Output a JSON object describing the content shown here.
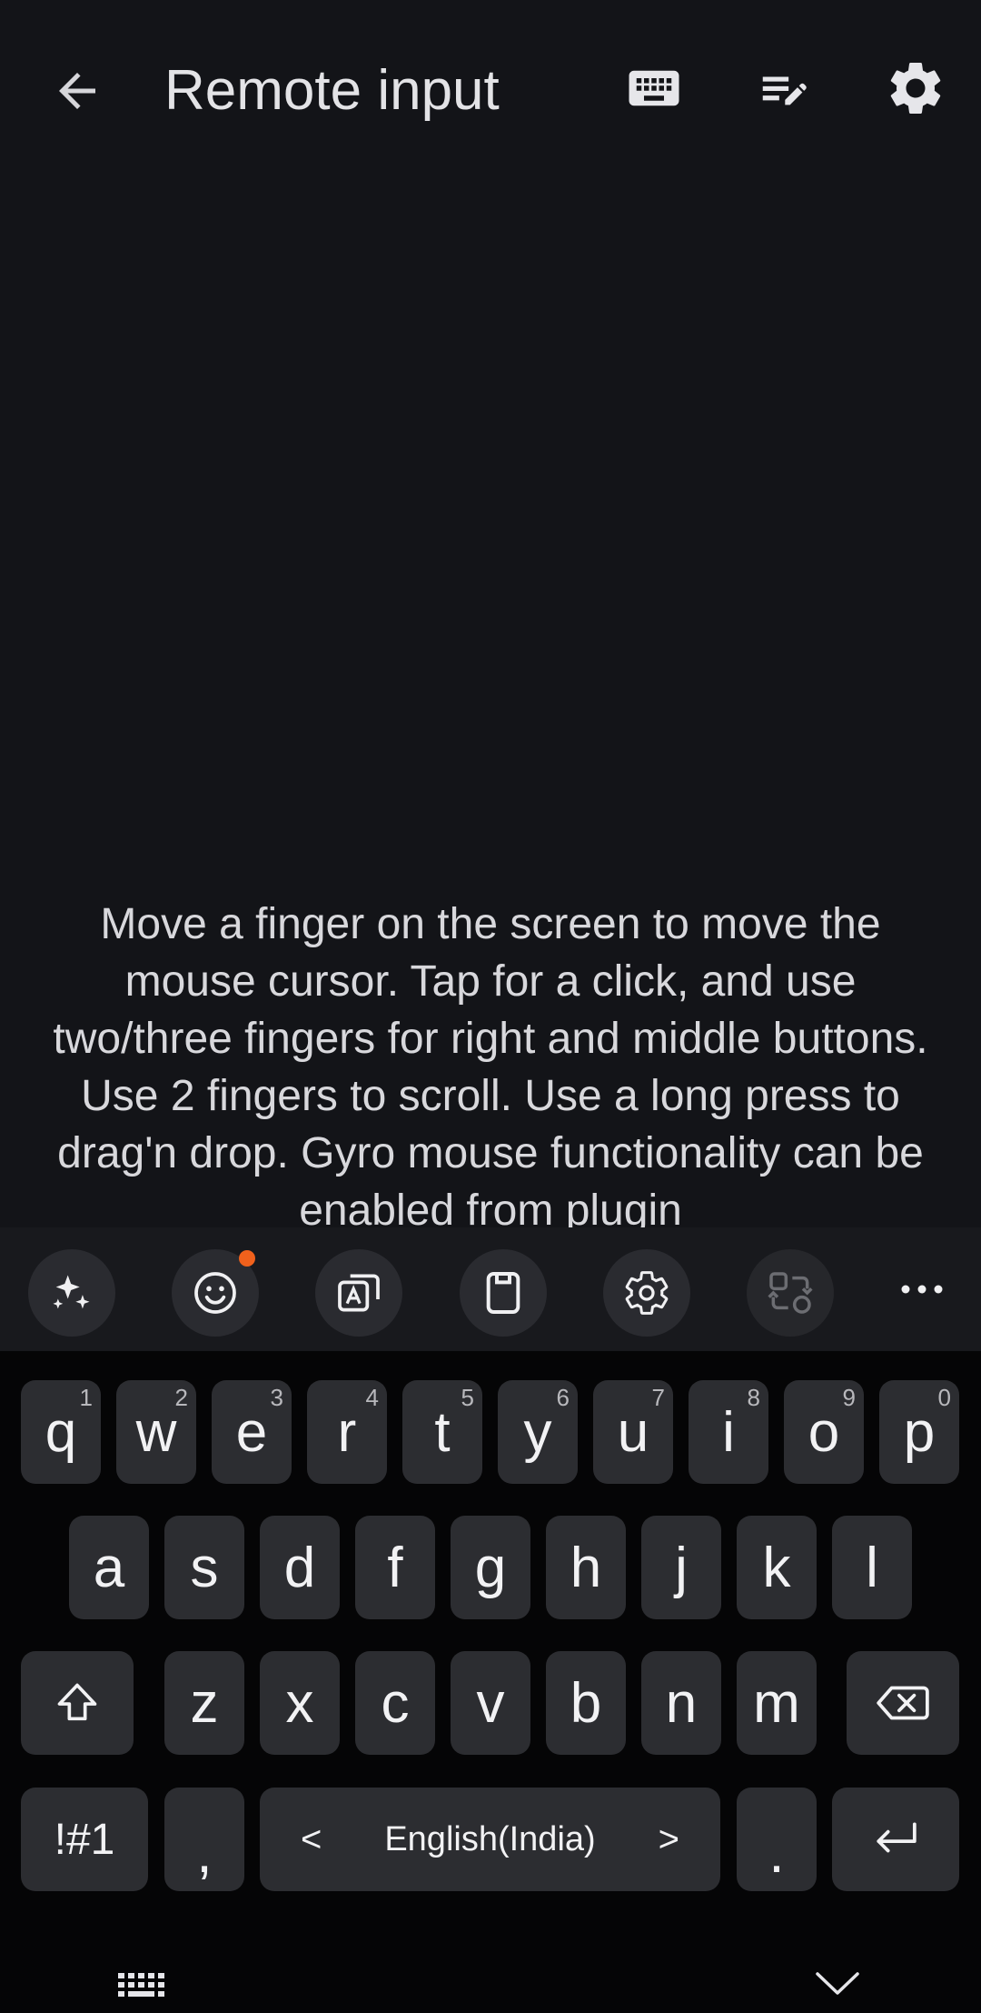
{
  "header": {
    "title": "Remote input",
    "back_icon": "arrow-left-icon",
    "keyboard_icon": "keyboard-icon",
    "edit_icon": "edit-list-icon",
    "settings_icon": "gear-icon"
  },
  "touchpad": {
    "help_text": "Move a finger on the screen to move the mouse cursor. Tap for a click, and use two/three fingers for right and middle buttons. Use 2 fingers to scroll. Use a long press to drag'n drop. Gyro mouse functionality can be enabled from plugin"
  },
  "keyboard_toolbar": {
    "tools": [
      "sparkle-ai-icon",
      "emoji-icon",
      "translate-icon",
      "clipboard-icon",
      "settings-icon",
      "convert-icon"
    ],
    "more": "⋯",
    "notification_color": "#f0611c"
  },
  "keyboard": {
    "row1": [
      {
        "key": "q",
        "hint": "1"
      },
      {
        "key": "w",
        "hint": "2"
      },
      {
        "key": "e",
        "hint": "3"
      },
      {
        "key": "r",
        "hint": "4"
      },
      {
        "key": "t",
        "hint": "5"
      },
      {
        "key": "y",
        "hint": "6"
      },
      {
        "key": "u",
        "hint": "7"
      },
      {
        "key": "i",
        "hint": "8"
      },
      {
        "key": "o",
        "hint": "9"
      },
      {
        "key": "p",
        "hint": "0"
      }
    ],
    "row2": [
      "a",
      "s",
      "d",
      "f",
      "g",
      "h",
      "j",
      "k",
      "l"
    ],
    "row3": [
      "z",
      "x",
      "c",
      "v",
      "b",
      "n",
      "m"
    ],
    "symbols_label": "!#1",
    "comma": ",",
    "period": ".",
    "language": "English(India)",
    "lang_prev": "<",
    "lang_next": ">"
  },
  "colors": {
    "background": "#131418",
    "key": "#2c2d31",
    "keyboard_bg": "#050506",
    "text": "#e3e3e6"
  }
}
